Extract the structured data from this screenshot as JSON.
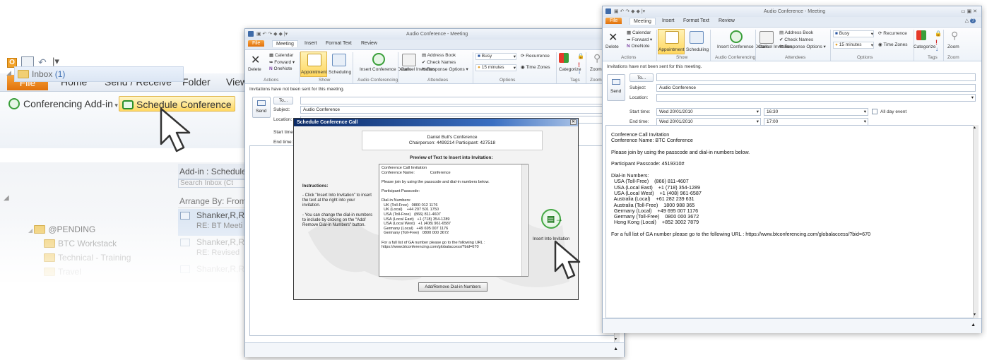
{
  "outlook": {
    "tabs": [
      "File",
      "Home",
      "Send / Receive",
      "Folder",
      "View"
    ],
    "conferencing_addin": "Conferencing Add-in",
    "schedule_conference": "Schedule Conference",
    "addin_panel_title": "Add-in : Schedule",
    "search_placeholder": "Search Inbox (Ct",
    "arrange_by": "Arrange By: From",
    "folders": {
      "inbox": "Inbox",
      "inbox_count": "(1)",
      "pending": "@PENDING",
      "btc_workstack": "BTC Workstack",
      "technical_training": "Technical - Training",
      "travel": "Travel"
    },
    "mail_items": [
      {
        "from": "Shanker,R,R",
        "subject": "RE: BT Meeti"
      },
      {
        "from": "Shanker,R,R",
        "subject": "RE: Revised"
      },
      {
        "from": "Shanker,R,R",
        "subject": ""
      }
    ]
  },
  "meeting_window": {
    "title": "Audio Conference - Meeting",
    "tabs": [
      "File",
      "Meeting",
      "Insert",
      "Format Text",
      "Review"
    ],
    "ribbon": {
      "delete": "Delete",
      "calendar": "Calendar",
      "forward": "Forward",
      "onenote": "OneNote",
      "appointment": "Appointment",
      "scheduling": "Scheduling",
      "insert_conference_details": "Insert Conference Details",
      "cancel_invitation": "Cancel Invitation",
      "address_book": "Address Book",
      "check_names": "Check Names",
      "response_options": "Response Options",
      "busy": "Busy",
      "recurrence": "Recurrence",
      "reminder": "15 minutes",
      "time_zones": "Time Zones",
      "categorize": "Categorize",
      "zoom": "Zoom",
      "groups": [
        "Actions",
        "Show",
        "Audio Conferencing",
        "Attendees",
        "Options",
        "Tags",
        "Zoom"
      ]
    },
    "notice": "Invitations have not been sent for this meeting.",
    "to_label": "To...",
    "send_label": "Send",
    "subject_label": "Subject:",
    "subject_value": "Audio Conference",
    "location_label": "Location:",
    "start_label": "Start time:",
    "end_label": "End time:",
    "start_date": "Wed 20/01/2010",
    "start_time": "16:30",
    "end_date": "Wed 20/01/2010",
    "end_time": "17:00",
    "all_day": "All day event"
  },
  "dialog": {
    "title": "Schedule Conference Call",
    "header_line1": "Daniel Bull's Conference",
    "header_line2": "Chairperson: 4499214  Participant: 427518",
    "preview_title": "Preview of Text to Insert into Invitation:",
    "instructions_title": "Instructions:",
    "instruction_1": "- Click \"Insert Into Invitation\" to insert the text at the right into your invitation.",
    "instruction_2": "- You can change the dial-in numbers to include by clicking on the \"Add/ Remove Dial-in Numbers\" button.",
    "preview_text": "Conference Call Invitation\nConference Name:              Conference\n\nPlease join by using the passcode and dial-in numbers below.\n\nParticipant Passcode:\n\nDial-in Numbers:\n  UK (Toll-Free)   0800 012 1176\n  UK (Local)    +44 207 501 1750\n  USA (Toll-Free)   (866) 811-4607\n  USA (Local East)   +1 (718) 354-1289\n  USA (Local West)   +1 (408) 961-6587\n  Germany (Local)   +49 695 007 1176\n  Germany (Toll-Free)   0800 000 3672\n\nFor a full list of GA number please go to the following URL :\nhttps://www.btconferencing.com/globalaccess/?bid=670",
    "insert_label": "Insert Into Invitation",
    "add_remove": "Add/Remove Dial-in Numbers"
  },
  "right_window": {
    "body_text": "Conference Call Invitation\nConference Name: BTC Conference\n\nPlease join by using the passcode and dial-in numbers below.\n\nParticipant Passcode: 4519310#\n\nDial-in Numbers:\n  USA (Toll-Free)    (866) 811-4607\n  USA (Local East)    +1 (718) 354-1289\n  USA (Local West)    +1 (408) 961-6587\n  Australia (Local)    +61 282 239 631\n  Australia (Toll-Free)    1800 988 365\n  Germany (Local)    +49 695 007 1176\n  Germany (Toll-Free)    0800 000 3672\n  Hong Kong (Local)    +852 3002 7879\n\nFor a full list of GA number please go to the following URL : https://www.btconferencing.com/globalaccess/?bid=670"
  }
}
